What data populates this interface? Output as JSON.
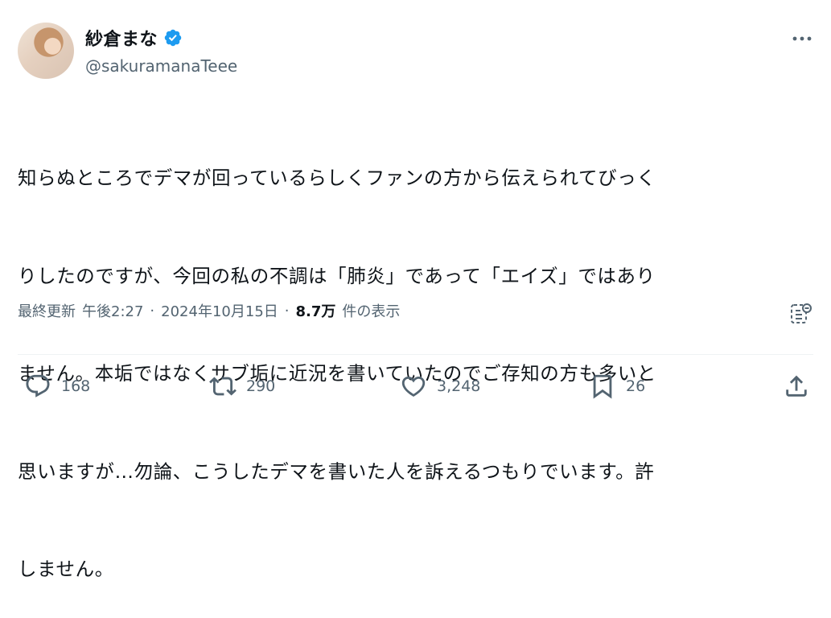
{
  "user": {
    "display_name": "紗倉まな",
    "handle": "@sakuramanaTeee",
    "verified_color": "#1d9bf0"
  },
  "tweet": {
    "text_lines": [
      "知らぬところでデマが回っているらしくファンの方から伝えられてびっく",
      "りしたのですが、今回の私の不調は「肺炎」であって「エイズ」ではあり",
      "ません。本垢ではなくサブ垢に近況を書いていたのでご存知の方も多いと",
      "思いますが…勿論、こうしたデマを書いた人を訴えるつもりでいます。許",
      "しません。"
    ]
  },
  "meta": {
    "prefix": "最終更新",
    "time": "午後2:27",
    "date": "2024年10月15日",
    "views": "8.7万",
    "views_label": "件の表示",
    "separator": "·"
  },
  "actions": {
    "replies": "168",
    "reposts": "290",
    "likes": "3,248",
    "bookmarks": "26"
  },
  "icons": {
    "more": "more-icon",
    "grok": "grok-icon",
    "reply": "reply-icon",
    "repost": "repost-icon",
    "like": "heart-icon",
    "bookmark": "bookmark-icon",
    "share": "share-icon"
  }
}
